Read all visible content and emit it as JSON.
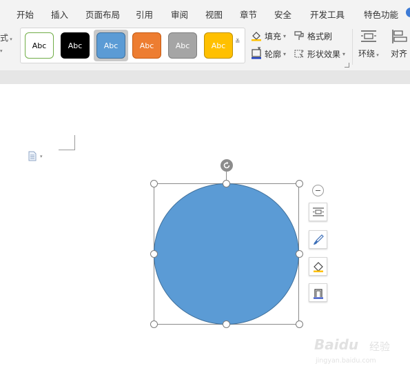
{
  "menu": {
    "items": [
      "开始",
      "插入",
      "页面布局",
      "引用",
      "审阅",
      "视图",
      "章节",
      "安全",
      "开发工具",
      "特色功能"
    ]
  },
  "ribbon": {
    "left_fragment_top": "式",
    "style_swatches": [
      {
        "label": "Abc",
        "fill": "#ffffff",
        "border": "#70ad47",
        "text_color": "#000000",
        "selected": false
      },
      {
        "label": "Abc",
        "fill": "#000000",
        "border": "#000000",
        "text_color": "#ffffff",
        "selected": false
      },
      {
        "label": "Abc",
        "fill": "#5b9bd5",
        "border": "#41719c",
        "text_color": "#ffffff",
        "selected": true
      },
      {
        "label": "Abc",
        "fill": "#ed7d31",
        "border": "#c55a11",
        "text_color": "#ffffff",
        "selected": false
      },
      {
        "label": "Abc",
        "fill": "#a5a5a5",
        "border": "#7f7f7f",
        "text_color": "#ffffff",
        "selected": false
      },
      {
        "label": "Abc",
        "fill": "#ffc000",
        "border": "#bf9000",
        "text_color": "#ffffff",
        "selected": false
      }
    ],
    "fill_label": "填充",
    "outline_label": "轮廓",
    "format_painter_label": "格式刷",
    "shape_effects_label": "形状效果",
    "wrap_label": "环绕",
    "align_label": "对齐"
  },
  "colors": {
    "shape_fill": "#5b9bd5",
    "shape_border": "#41719c",
    "ribbon_bg": "#f3f3f3",
    "accent": "#3d7bd6"
  },
  "watermark": {
    "brand": "Baidu",
    "cn": "经验",
    "url": "jingyan.baidu.com"
  }
}
